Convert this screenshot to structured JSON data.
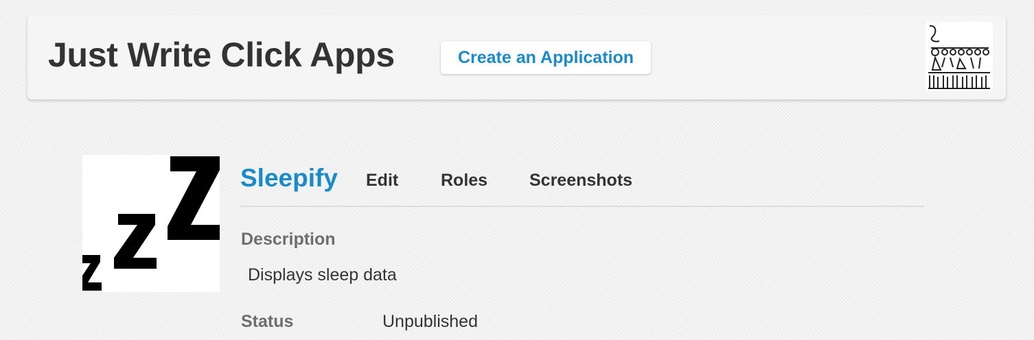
{
  "header": {
    "title": "Just Write Click Apps",
    "create_button_label": "Create an Application",
    "user_avatar_icon": "user-avatar-sketch-icon"
  },
  "app": {
    "icon": "sleep-zzz-icon",
    "name": "Sleepify",
    "nav": [
      {
        "label": "Edit"
      },
      {
        "label": "Roles"
      },
      {
        "label": "Screenshots"
      }
    ],
    "description_label": "Description",
    "description": "Displays sleep data",
    "status_label": "Status",
    "status": "Unpublished"
  },
  "colors": {
    "accent": "#1a8bc9",
    "text": "#333333",
    "label": "#6e6e6e",
    "header_bg": "#f5f5f5"
  }
}
